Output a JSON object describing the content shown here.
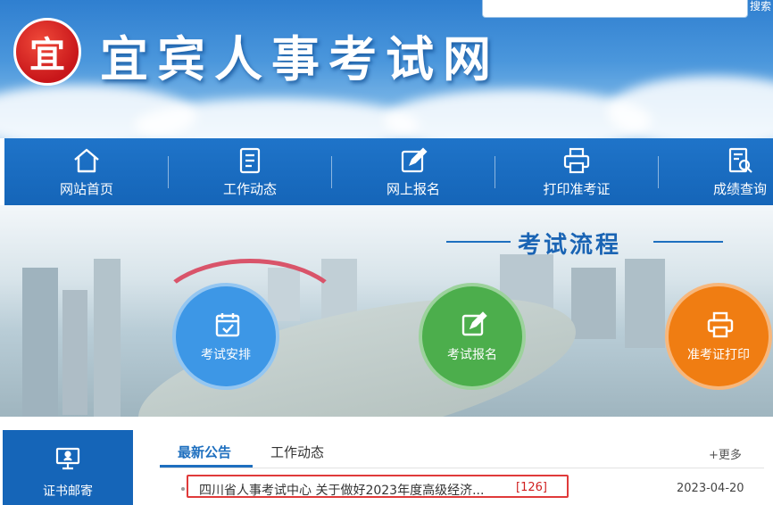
{
  "header": {
    "logo_text": "",
    "site_title": "宜宾人事考试网",
    "search": {
      "placeholder": "",
      "button_label": "搜索"
    }
  },
  "nav": {
    "items": [
      {
        "label": "网站首页",
        "icon": "home-icon"
      },
      {
        "label": "工作动态",
        "icon": "document-list-icon"
      },
      {
        "label": "网上报名",
        "icon": "edit-icon"
      },
      {
        "label": "打印准考证",
        "icon": "printer-icon"
      },
      {
        "label": "成绩查询",
        "icon": "score-search-icon"
      }
    ]
  },
  "banner": {
    "title": "考试流程",
    "steps": [
      {
        "label": "考试安排",
        "color": "#3d97e6",
        "icon": "calendar-check-icon"
      },
      {
        "label": "考试报名",
        "color": "#4cae4c",
        "icon": "edit-icon"
      },
      {
        "label": "准考证打印",
        "color": "#f07d12",
        "icon": "printer-icon"
      }
    ]
  },
  "sidebar": {
    "cert_mail_label": "证书邮寄"
  },
  "news": {
    "tabs": [
      {
        "label": "最新公告",
        "active": true
      },
      {
        "label": "工作动态",
        "active": false
      }
    ],
    "more_label": "+更多",
    "items": [
      {
        "title": "四川省人事考试中心 关于做好2023年度高级经济...",
        "count": "[126]",
        "date": "2023-04-20"
      }
    ]
  },
  "colors": {
    "nav_bg": "#1565b8",
    "accent": "#1e6fbf",
    "highlight_border": "#e03a3a"
  }
}
